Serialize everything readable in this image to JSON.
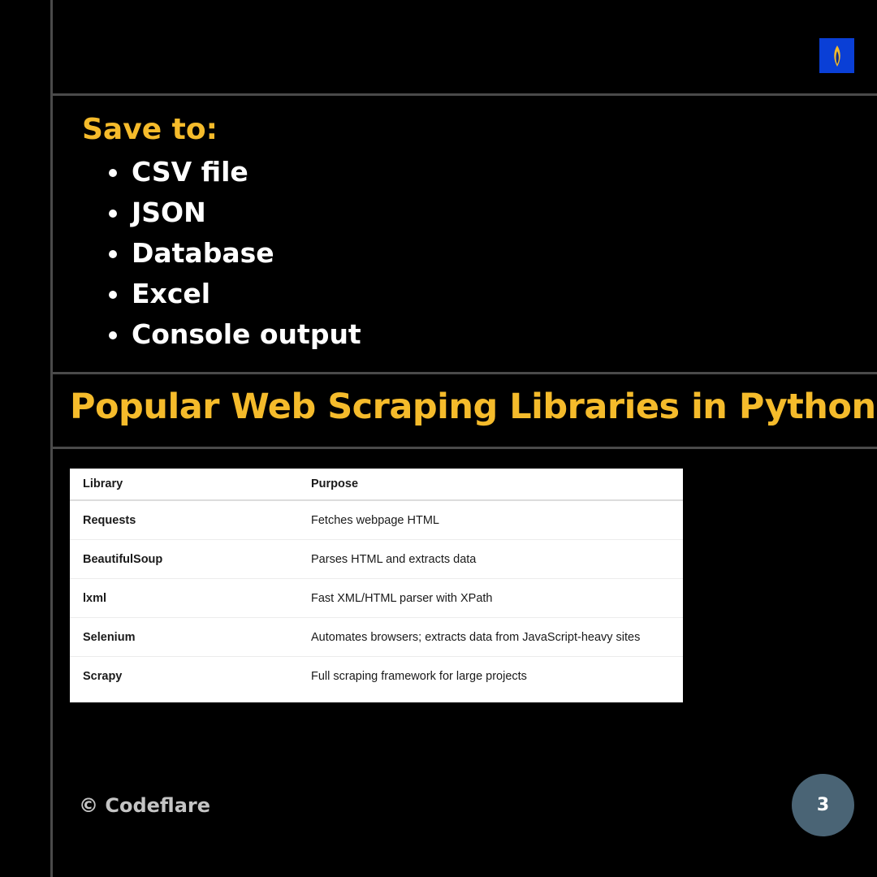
{
  "colors": {
    "accent": "#f5bb2b",
    "background": "#000000",
    "text": "#ffffff",
    "logo_bg": "#0a3fd6",
    "page_badge": "#4a6475"
  },
  "logo": {
    "icon": "flame-logo-icon"
  },
  "save_section": {
    "heading": "Save to:",
    "items": [
      "CSV file",
      "JSON",
      "Database",
      "Excel",
      "Console output"
    ]
  },
  "libraries_section": {
    "title": "Popular Web Scraping Libraries in Python",
    "table": {
      "headers": [
        "Library",
        "Purpose"
      ],
      "rows": [
        [
          "Requests",
          "Fetches webpage HTML"
        ],
        [
          "BeautifulSoup",
          "Parses HTML and extracts data"
        ],
        [
          "lxml",
          "Fast XML/HTML parser with XPath"
        ],
        [
          "Selenium",
          "Automates browsers; extracts data from JavaScript-heavy sites"
        ],
        [
          "Scrapy",
          "Full scraping framework for large projects"
        ]
      ]
    }
  },
  "footer": {
    "brand": "© Codeflare",
    "page_number": "3"
  }
}
